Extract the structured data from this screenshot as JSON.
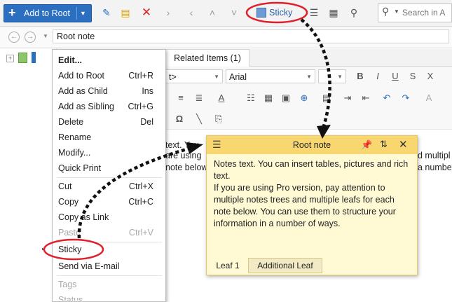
{
  "toolbar": {
    "add_root_label": "Add to Root",
    "sticky_label": "Sticky",
    "search_placeholder": "Search in A"
  },
  "address": {
    "value": "Root note"
  },
  "editor": {
    "tab_related": "Related Items  (1)",
    "style_combo": "t>",
    "font_combo": "Arial",
    "text_line1": "text. You",
    "text_line2": "are using",
    "text_line3": "note below",
    "text_right1": "d multipl",
    "text_right2": "a numbe"
  },
  "context_menu": {
    "items": [
      {
        "label": "Edit...",
        "shortcut": ""
      },
      {
        "label": "Add to Root",
        "shortcut": "Ctrl+R"
      },
      {
        "label": "Add as Child",
        "shortcut": "Ins"
      },
      {
        "label": "Add as Sibling",
        "shortcut": "Ctrl+G"
      },
      {
        "label": "Delete",
        "shortcut": "Del"
      },
      {
        "label": "Rename",
        "shortcut": ""
      },
      {
        "label": "Modify...",
        "shortcut": ""
      },
      {
        "label": "Quick Print",
        "shortcut": ""
      },
      {
        "label": "Cut",
        "shortcut": "Ctrl+X"
      },
      {
        "label": "Copy",
        "shortcut": "Ctrl+C"
      },
      {
        "label": "Copy as Link",
        "shortcut": ""
      },
      {
        "label": "Paste",
        "shortcut": "Ctrl+V"
      },
      {
        "label": "Sticky",
        "shortcut": ""
      },
      {
        "label": "Send via E-mail",
        "shortcut": ""
      },
      {
        "label": "Tags",
        "shortcut": ""
      },
      {
        "label": "Status",
        "shortcut": ""
      }
    ]
  },
  "sticky_note": {
    "title": "Root note",
    "body": "Notes text. You can insert tables, pictures and rich text.\nIf you are using Pro version, pay attention to multiple notes trees and multiple leafs for each note below. You can use them to structure your information in a number of ways.",
    "tab_leaf1": "Leaf 1",
    "tab_additional": "Additional Leaf"
  },
  "colors": {
    "accent": "#2b6fc1",
    "highlight_ring": "#e0202a",
    "sticky_header": "#f8d770",
    "sticky_body": "#fff9d4"
  }
}
